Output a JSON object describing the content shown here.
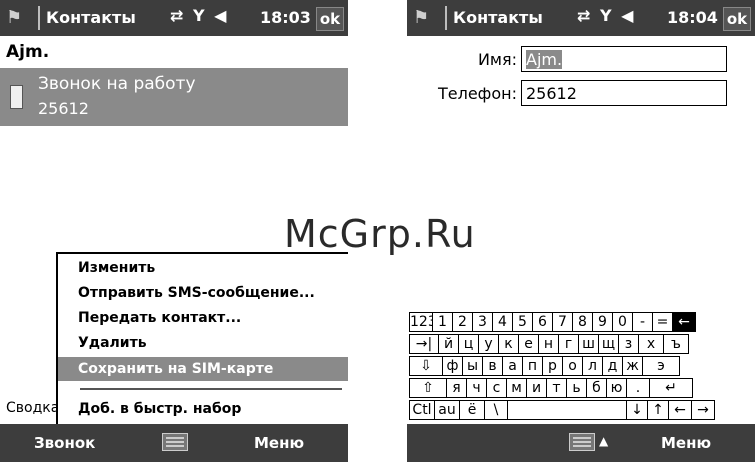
{
  "watermark": "McGrp.Ru",
  "left_screen": {
    "title": "Контакты",
    "time": "18:03",
    "ok_label": "ok",
    "contact_name": "Ajm.",
    "entry": {
      "label": "Звонок на работу",
      "number": "25612"
    },
    "menu": {
      "items": [
        "Изменить",
        "Отправить SMS-сообщение...",
        "Передать контакт...",
        "Удалить",
        "Сохранить на SIM-карте"
      ],
      "after_divider": "Доб. в быстр. набор",
      "selected_index": 4
    },
    "summary_tab": "Сводка",
    "softkeys": {
      "left": "Звонок",
      "right": "Меню"
    }
  },
  "right_screen": {
    "title": "Контакты",
    "time": "18:04",
    "ok_label": "ok",
    "fields": [
      {
        "label": "Имя:",
        "value": "Ajm."
      },
      {
        "label": "Телефон:",
        "value": "25612"
      }
    ],
    "keyboard": {
      "rows": [
        [
          "123",
          "1",
          "2",
          "3",
          "4",
          "5",
          "6",
          "7",
          "8",
          "9",
          "0",
          "-",
          "=",
          "←"
        ],
        [
          "→|",
          "й",
          "ц",
          "у",
          "к",
          "е",
          "н",
          "г",
          "ш",
          "щ",
          "з",
          "х",
          "ъ"
        ],
        [
          "⇩",
          "ф",
          "ы",
          "в",
          "а",
          "п",
          "р",
          "о",
          "л",
          "д",
          "ж",
          "э"
        ],
        [
          "⇧",
          "я",
          "ч",
          "с",
          "м",
          "и",
          "т",
          "ь",
          "б",
          "ю",
          ".",
          "↵"
        ],
        [
          "Ctl",
          "au",
          "ё",
          "\\",
          " ",
          "↓",
          "↑",
          "←",
          "→"
        ]
      ]
    },
    "softkeys": {
      "right": "Меню"
    }
  },
  "colors": {
    "titlebar": "#3d3d3d",
    "selection": "#8a8a8a",
    "watermark": "#2a2a2a"
  },
  "icons": [
    "windows-flag-icon",
    "sync-icon",
    "signal-icon",
    "speaker-icon",
    "phone-icon",
    "keyboard-icon"
  ]
}
